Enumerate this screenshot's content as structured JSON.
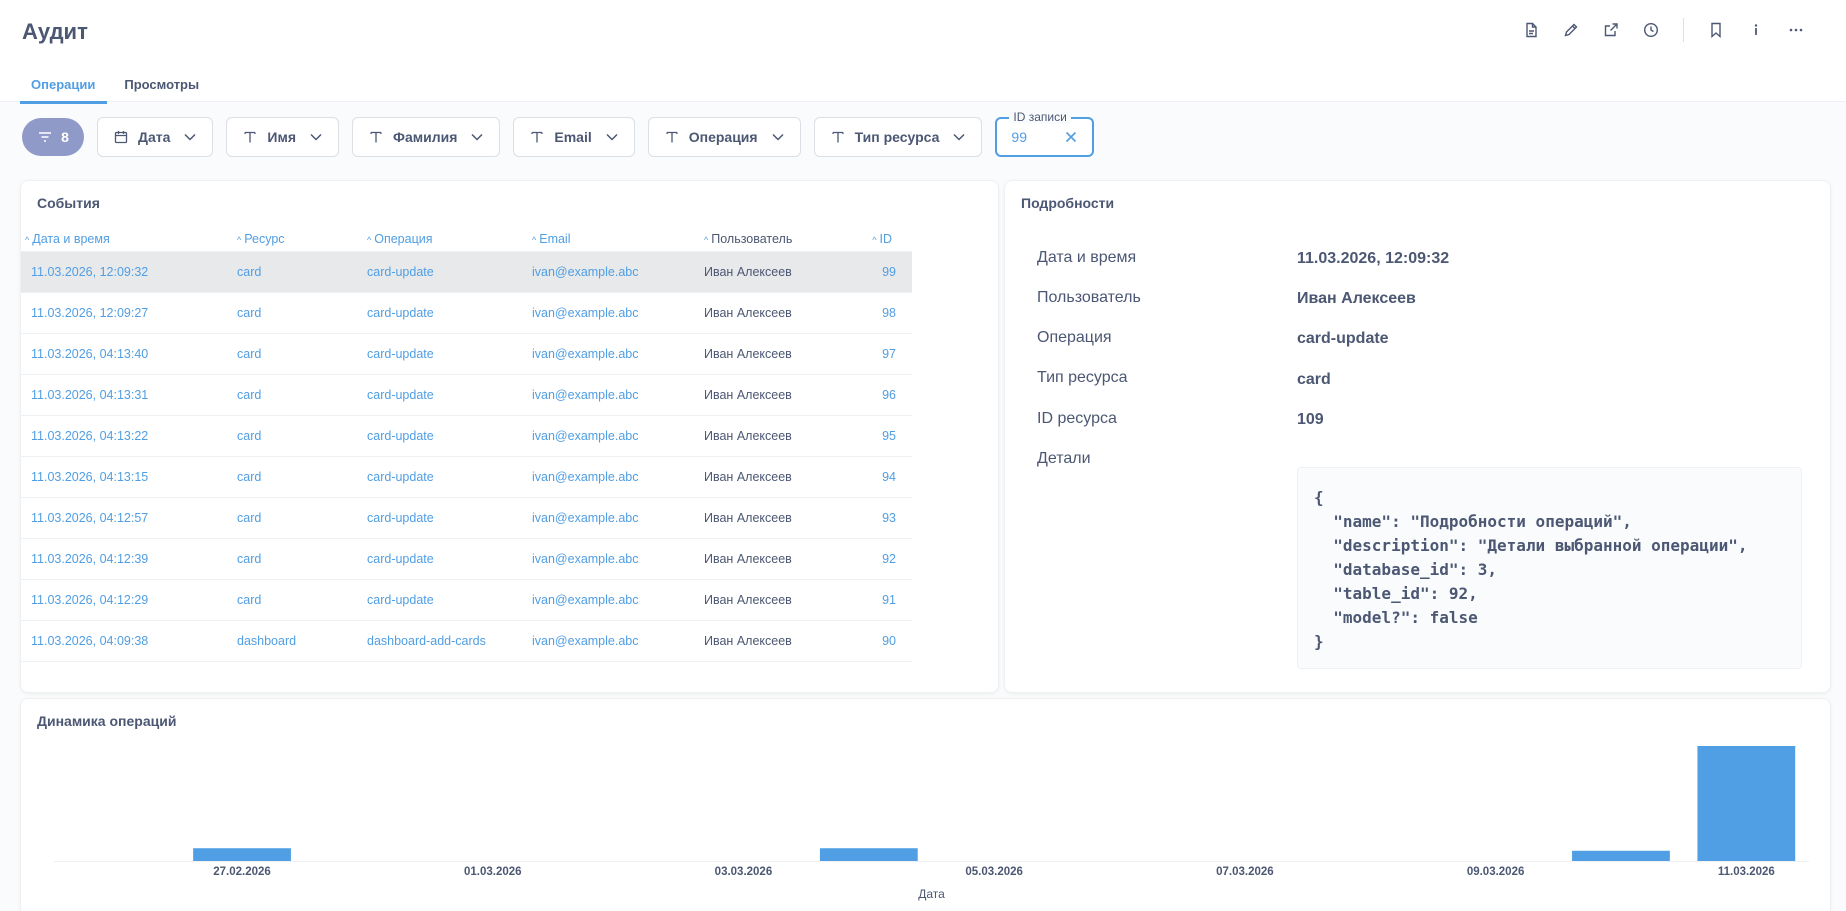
{
  "page": {
    "title": "Аудит"
  },
  "tabs": [
    {
      "label": "Операции",
      "active": true
    },
    {
      "label": "Просмотры",
      "active": false
    }
  ],
  "filters": {
    "count": "8",
    "items": [
      {
        "label": "Дата",
        "icon": "calendar-icon"
      },
      {
        "label": "Имя",
        "icon": "text-type-icon"
      },
      {
        "label": "Фамилия",
        "icon": "text-type-icon"
      },
      {
        "label": "Email",
        "icon": "text-type-icon"
      },
      {
        "label": "Операция",
        "icon": "text-type-icon"
      },
      {
        "label": "Тип ресурса",
        "icon": "text-type-icon"
      }
    ],
    "record_id": {
      "label": "ID записи",
      "value": "99"
    }
  },
  "events": {
    "title": "События",
    "columns": [
      "Дата и время",
      "Ресурс",
      "Операция",
      "Email",
      "Пользователь",
      "ID"
    ],
    "rows": [
      [
        "11.03.2026, 12:09:32",
        "card",
        "card-update",
        "ivan@example.abc",
        "Иван Алексеев",
        "99"
      ],
      [
        "11.03.2026, 12:09:27",
        "card",
        "card-update",
        "ivan@example.abc",
        "Иван Алексеев",
        "98"
      ],
      [
        "11.03.2026, 04:13:40",
        "card",
        "card-update",
        "ivan@example.abc",
        "Иван Алексеев",
        "97"
      ],
      [
        "11.03.2026, 04:13:31",
        "card",
        "card-update",
        "ivan@example.abc",
        "Иван Алексеев",
        "96"
      ],
      [
        "11.03.2026, 04:13:22",
        "card",
        "card-update",
        "ivan@example.abc",
        "Иван Алексеев",
        "95"
      ],
      [
        "11.03.2026, 04:13:15",
        "card",
        "card-update",
        "ivan@example.abc",
        "Иван Алексеев",
        "94"
      ],
      [
        "11.03.2026, 04:12:57",
        "card",
        "card-update",
        "ivan@example.abc",
        "Иван Алексеев",
        "93"
      ],
      [
        "11.03.2026, 04:12:39",
        "card",
        "card-update",
        "ivan@example.abc",
        "Иван Алексеев",
        "92"
      ],
      [
        "11.03.2026, 04:12:29",
        "card",
        "card-update",
        "ivan@example.abc",
        "Иван Алексеев",
        "91"
      ],
      [
        "11.03.2026, 04:09:38",
        "dashboard",
        "dashboard-add-cards",
        "ivan@example.abc",
        "Иван Алексеев",
        "90"
      ]
    ]
  },
  "details": {
    "title": "Подробности",
    "fields": [
      {
        "label": "Дата и время",
        "value": "11.03.2026, 12:09:32"
      },
      {
        "label": "Пользователь",
        "value": "Иван Алексеев"
      },
      {
        "label": "Операция",
        "value": "card-update"
      },
      {
        "label": "Тип ресурса",
        "value": "card"
      },
      {
        "label": "ID ресурса",
        "value": "109"
      },
      {
        "label": "Детали",
        "value": ""
      }
    ],
    "json": "{\n  \"name\": \"Подробности операций\",\n  \"description\": \"Детали выбранной операции\",\n  \"database_id\": 3,\n  \"table_id\": 92,\n  \"model?\": false\n}"
  },
  "dynamics": {
    "title": "Динамика операций"
  },
  "chart_data": {
    "type": "bar",
    "title": "Динамика операций",
    "xlabel": "Дата",
    "ylabel": "",
    "x_ticks": [
      "27.02.2026",
      "01.03.2026",
      "03.03.2026",
      "05.03.2026",
      "07.03.2026",
      "09.03.2026",
      "11.03.2026"
    ],
    "categories": [
      "27.02.2026",
      "04.03.2026",
      "10.03.2026",
      "11.03.2026"
    ],
    "values": [
      1,
      1,
      0.8,
      9
    ],
    "color": "#509ee3",
    "grid": false
  },
  "colors": {
    "accent": "#509ee3",
    "text": "#4c5773",
    "filter_badge": "#8f9ac9",
    "selected_row": "#e8e9eb"
  }
}
